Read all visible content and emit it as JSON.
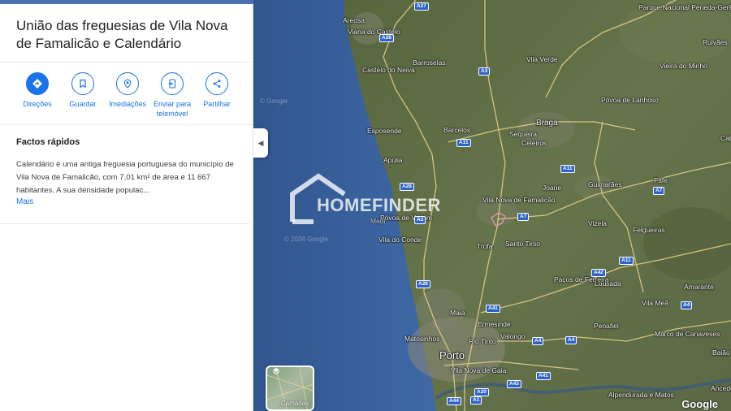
{
  "panel": {
    "title": "União das freguesias de Vila Nova de Famalicão e Calendário",
    "actions": [
      {
        "label": "Direções",
        "icon": "directions-icon"
      },
      {
        "label": "Guardar",
        "icon": "bookmark-icon"
      },
      {
        "label": "Imediações",
        "icon": "nearby-icon"
      },
      {
        "label": "Enviar para telemóvel",
        "icon": "send-to-phone-icon"
      },
      {
        "label": "Partilhar",
        "icon": "share-icon"
      }
    ],
    "quick_facts_title": "Factos rápidos",
    "quick_facts_text": "Calendário é uma antiga freguesia portuguesa do município de Vila Nova de Famalicão, com 7,01 km² de área e 11 667 habitantes. A sua densidade populac...",
    "more_link": "Mais"
  },
  "map": {
    "places": {
      "areosa": "Areosa",
      "viana": "Viana do Castelo",
      "barroselas": "Barroselas",
      "castelo_neiva": "Castelo do Neiva",
      "vila_verde": "Vila Verde",
      "peneda": "Parque Nacional Peneda-Gerês",
      "ruivaes": "Ruivães",
      "vieira": "Vieira do Minho",
      "povoa_lanhoso": "Póvoa de Lanhoso",
      "braga": "Braga",
      "esposende": "Esposende",
      "barcelos": "Barcelos",
      "sequeira": "Sequeira",
      "celeiros": "Celeiros",
      "apulia": "Apúlia",
      "joane": "Joane",
      "guimaraes": "Guimarães",
      "fafe": "Fafe",
      "vnf": "Vila Nova de Famalicão",
      "povoa_varzim": "Póvoa de Varzim",
      "vila_conde": "Vila do Conde",
      "trofa": "Trofa",
      "santo_tirso": "Santo Tirso",
      "vizela": "Vizela",
      "felgueiras": "Felgueiras",
      "pacos_ferreira": "Paços de Ferreira",
      "lousada": "Lousada",
      "amarante": "Amarante",
      "vila_mea": "Vila Meã",
      "maia": "Maia",
      "ermesinde": "Ermesinde",
      "matosinhos": "Matosinhos",
      "valongo": "Valongo",
      "rio_tinto": "Rio Tinto",
      "penafiel": "Penafiel",
      "marco_canaveses": "Marco de Canaveses",
      "porto": "Porto",
      "vn_gaia": "Vila Nova de Gaia",
      "baiao": "Baião",
      "ancede": "Ancede",
      "alpendurada": "Alpendurada e Matos",
      "cab": "Cab",
      "medi": "Medi"
    },
    "road_shields": {
      "a27": "A27",
      "a28_n": "A28",
      "a3": "A3",
      "a11_w": "A11",
      "a11_e": "A11",
      "a28_m": "A28",
      "a7_e": "A7",
      "a7_m": "A7",
      "a42": "A42",
      "a28_s": "A28",
      "a41": "A41",
      "a4": "A4",
      "a41_s": "A41",
      "a4_s": "A4",
      "a43": "A43",
      "a20": "A20",
      "a44": "A44",
      "a1": "A1",
      "a4_e": "A4",
      "a11_s": "A11",
      "a2": "A2"
    },
    "copyright_1": "© Google",
    "copyright_2": "© 2024 Google",
    "google": "Google",
    "watermark": "HOMEFINDER",
    "layers_label": "Camadas",
    "colors": {
      "sea": "#3a609c",
      "land": "#5e6e46",
      "accent": "#1a73e8",
      "road": "#e8d28a"
    }
  }
}
